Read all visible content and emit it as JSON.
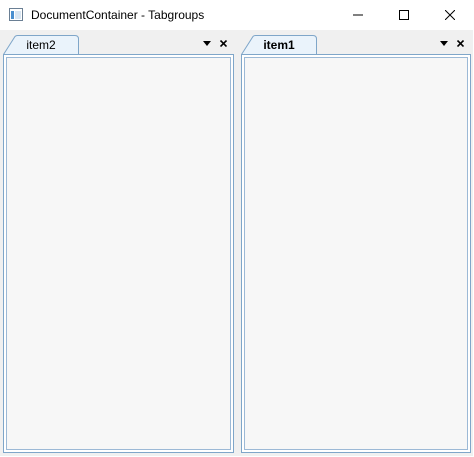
{
  "window": {
    "title": "DocumentContainer - Tabgroups",
    "icon": "app-window-icon",
    "controls": {
      "minimize_icon": "minimize-icon",
      "maximize_icon": "maximize-icon",
      "close_icon": "close-icon"
    }
  },
  "tab_groups": [
    {
      "tabs": [
        {
          "label": "item2",
          "active": false
        }
      ],
      "menu_icon": "dropdown-arrow-icon",
      "close_icon": "close-icon"
    },
    {
      "tabs": [
        {
          "label": "item1",
          "active": true
        }
      ],
      "menu_icon": "dropdown-arrow-icon",
      "close_icon": "close-icon"
    }
  ],
  "colors": {
    "accent_border": "#7fa6c9",
    "tab_fill": "#eaf3fb",
    "panel_bg": "#f7f7f7"
  }
}
